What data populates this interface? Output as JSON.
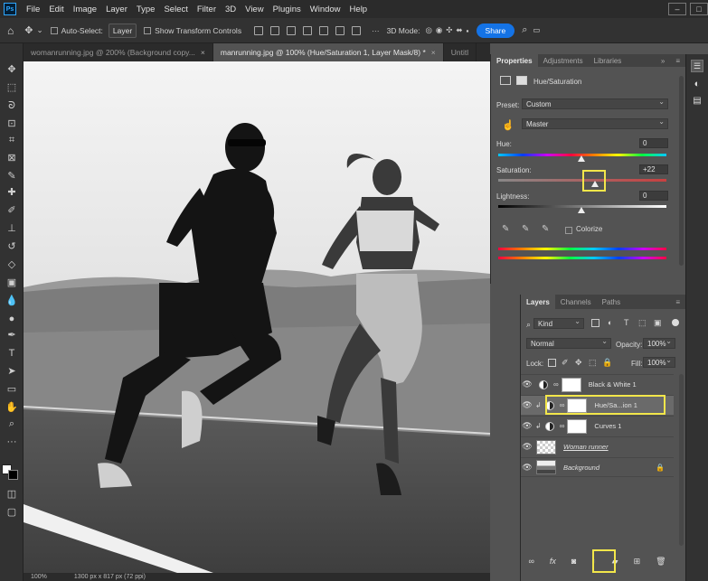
{
  "app": {
    "logo": "Ps"
  },
  "menu": [
    "File",
    "Edit",
    "Image",
    "Layer",
    "Type",
    "Select",
    "Filter",
    "3D",
    "View",
    "Plugins",
    "Window",
    "Help"
  ],
  "options_bar": {
    "auto_select_label": "Auto-Select:",
    "auto_select_value": "Layer",
    "show_transform_label": "Show Transform Controls",
    "mode_3d_label": "3D Mode:",
    "share_label": "Share"
  },
  "tabs": [
    {
      "label": "womanrunning.jpg @ 200% (Background copy...",
      "active": false
    },
    {
      "label": "manrunning.jpg @ 100% (Hue/Saturation 1, Layer Mask/8) *",
      "active": true
    },
    {
      "label": "Untitl",
      "active": false
    }
  ],
  "status": {
    "zoom": "100%",
    "dimensions": "1300 px x 817 px (72 ppi)"
  },
  "properties": {
    "tabs": [
      "Properties",
      "Adjustments",
      "Libraries"
    ],
    "title": "Hue/Saturation",
    "preset_label": "Preset:",
    "preset_value": "Custom",
    "channel_value": "Master",
    "hue_label": "Hue:",
    "hue_value": "0",
    "saturation_label": "Saturation:",
    "saturation_value": "+22",
    "lightness_label": "Lightness:",
    "lightness_value": "0",
    "colorize_label": "Colorize"
  },
  "layers": {
    "tabs": [
      "Layers",
      "Channels",
      "Paths"
    ],
    "kind_label": "Kind",
    "blend_mode": "Normal",
    "opacity_label": "Opacity:",
    "opacity_value": "100%",
    "lock_label": "Lock:",
    "fill_label": "Fill:",
    "fill_value": "100%",
    "items": [
      {
        "name": "Black & White 1"
      },
      {
        "name": "Hue/Sa...ion 1"
      },
      {
        "name": "Curves 1"
      },
      {
        "name": "Woman runner"
      },
      {
        "name": "Background"
      }
    ]
  },
  "colors": {
    "highlight": "#f2e64a",
    "accent": "#1473e6"
  }
}
